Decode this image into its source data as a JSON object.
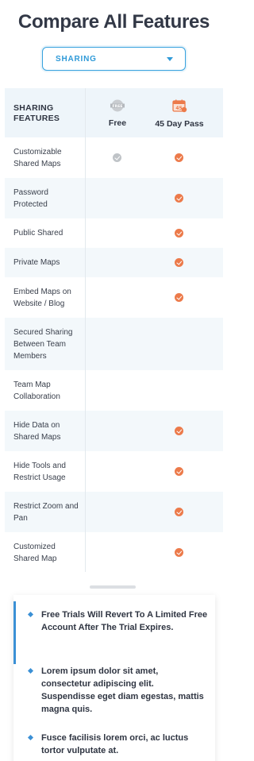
{
  "title": "Compare All Features",
  "category_select": {
    "value": "SHARING"
  },
  "table": {
    "header_label": "SHARING\nFEATURES",
    "plans": [
      {
        "name": "Free",
        "icon": "free-badge-icon"
      },
      {
        "name": "45 Day Pass",
        "icon": "calendar-45-icon"
      }
    ],
    "rows": [
      {
        "label": "Customizable Shared Maps",
        "free": true,
        "pass": true
      },
      {
        "label": "Password Protected",
        "free": false,
        "pass": true
      },
      {
        "label": "Public Shared",
        "free": false,
        "pass": true
      },
      {
        "label": "Private Maps",
        "free": false,
        "pass": true
      },
      {
        "label": "Embed Maps on Website / Blog",
        "free": false,
        "pass": true
      },
      {
        "label": "Secured Sharing Between Team Members",
        "free": false,
        "pass": false
      },
      {
        "label": "Team Map Collaboration",
        "free": false,
        "pass": false
      },
      {
        "label": "Hide Data on Shared Maps",
        "free": false,
        "pass": true
      },
      {
        "label": "Hide Tools and Restrict Usage",
        "free": false,
        "pass": true
      },
      {
        "label": "Restrict Zoom and Pan",
        "free": false,
        "pass": true
      },
      {
        "label": "Customized Shared Map",
        "free": false,
        "pass": true
      }
    ]
  },
  "notes": [
    "Free Trials Will Revert To A Limited Free Account After The Trial Expires.",
    "Lorem ipsum dolor sit amet, consectetur adipiscing elit. Suspendisse eget diam egestas, mattis magna quis.",
    "Fusce facilisis lorem orci, ac luctus tortor vulputate at."
  ],
  "colors": {
    "accent_blue": "#2f9ad8",
    "check_orange": "#ec7a4a",
    "check_grey": "#bfc3c7",
    "header_bg": "#eef5fa"
  }
}
